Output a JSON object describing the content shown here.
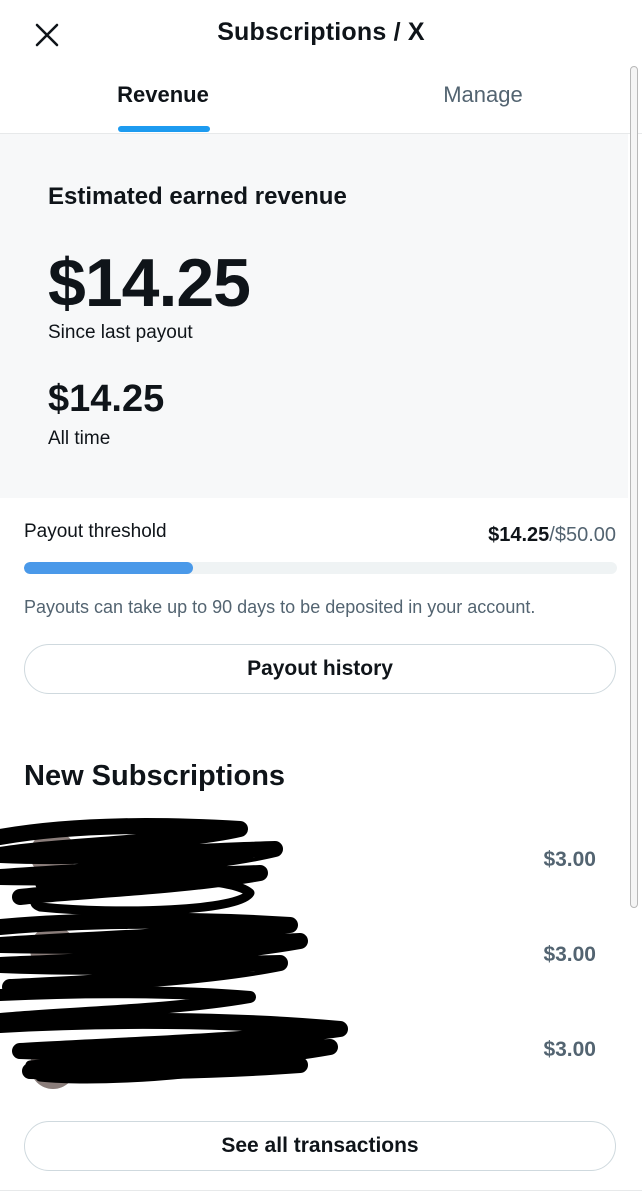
{
  "header": {
    "title": "Subscriptions / X",
    "close_icon": "close-icon"
  },
  "tabs": [
    {
      "label": "Revenue",
      "active": true
    },
    {
      "label": "Manage",
      "active": false
    }
  ],
  "revenue": {
    "section_title": "Estimated earned revenue",
    "since_last_payout_amount": "$14.25",
    "since_last_payout_label": "Since last payout",
    "all_time_amount": "$14.25",
    "all_time_label": "All time"
  },
  "payout": {
    "threshold_label": "Payout threshold",
    "current": "$14.25",
    "separator": "/",
    "max": "$50.00",
    "progress_fraction": 0.285,
    "note": "Payouts can take up to 90 days to be deposited in your account.",
    "history_button": "Payout history"
  },
  "subscriptions": {
    "heading": "New Subscriptions",
    "items": [
      {
        "amount": "$3.00"
      },
      {
        "amount": "$3.00"
      },
      {
        "amount": "$3.00"
      }
    ],
    "see_all_button": "See all transactions"
  },
  "colors": {
    "accent": "#1d9bf0",
    "progress": "#4a99e9",
    "panel_bg": "#f7f8f9",
    "secondary_text": "#536471"
  }
}
